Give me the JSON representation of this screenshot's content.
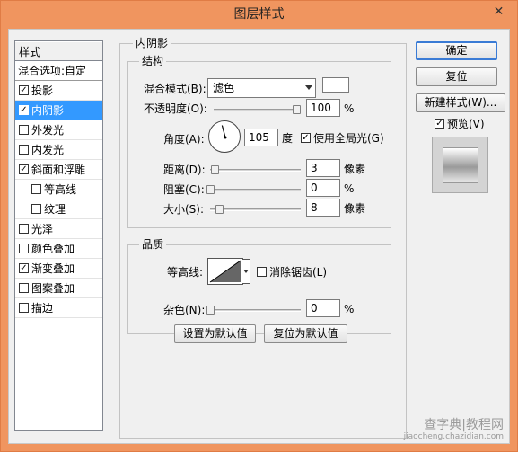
{
  "window": {
    "title": "图层样式",
    "close_glyph": "✕"
  },
  "styles_list": {
    "header": "样式",
    "blending_options": "混合选项:自定",
    "items": [
      {
        "label": "投影",
        "checked": true
      },
      {
        "label": "内阴影",
        "checked": true,
        "selected": true
      },
      {
        "label": "外发光",
        "checked": false
      },
      {
        "label": "内发光",
        "checked": false
      },
      {
        "label": "斜面和浮雕",
        "checked": true
      },
      {
        "label": "等高线",
        "checked": false,
        "indent": true
      },
      {
        "label": "纹理",
        "checked": false,
        "indent": true
      },
      {
        "label": "光泽",
        "checked": false
      },
      {
        "label": "颜色叠加",
        "checked": false
      },
      {
        "label": "渐变叠加",
        "checked": true
      },
      {
        "label": "图案叠加",
        "checked": false
      },
      {
        "label": "描边",
        "checked": false
      }
    ]
  },
  "inner_shadow": {
    "panel_title": "内阴影",
    "structure": {
      "title": "结构",
      "blend_mode_label": "混合模式(B):",
      "blend_mode_value": "滤色",
      "blend_color": "#ffffff",
      "opacity_label": "不透明度(O):",
      "opacity_value": "100",
      "opacity_unit": "%",
      "angle_label": "角度(A):",
      "angle_value": "105",
      "angle_unit": "度",
      "global_light_label": "使用全局光(G)",
      "global_light_checked": true,
      "distance_label": "距离(D):",
      "distance_value": "3",
      "distance_unit": "像素",
      "choke_label": "阻塞(C):",
      "choke_value": "0",
      "choke_unit": "%",
      "size_label": "大小(S):",
      "size_value": "8",
      "size_unit": "像素"
    },
    "quality": {
      "title": "品质",
      "contour_label": "等高线:",
      "anti_alias_label": "消除锯齿(L)",
      "anti_alias_checked": false,
      "noise_label": "杂色(N):",
      "noise_value": "0",
      "noise_unit": "%"
    },
    "set_default_label": "设置为默认值",
    "reset_default_label": "复位为默认值"
  },
  "right_panel": {
    "ok_label": "确定",
    "reset_label": "复位",
    "new_style_label": "新建样式(W)...",
    "preview_label": "预览(V)",
    "preview_checked": true
  },
  "watermark": {
    "line1": "查字典|教程网",
    "line2": "jiaocheng.chazidian.com"
  },
  "colors": {
    "titlebar": "#f0955f",
    "selection": "#3399ff",
    "dialog_bg": "#f0f0f0"
  }
}
